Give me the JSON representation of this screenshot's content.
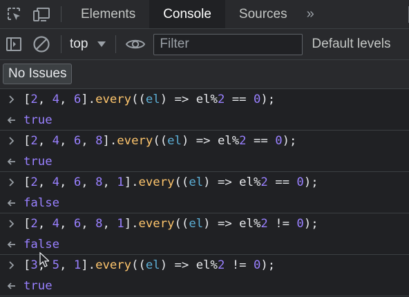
{
  "tabs": {
    "elements": "Elements",
    "console": "Console",
    "sources": "Sources",
    "more": "»"
  },
  "toolbar": {
    "context": "top",
    "filter_placeholder": "Filter",
    "levels": "Default levels"
  },
  "issues": {
    "label": "No Issues"
  },
  "colors": {
    "number": "#9980ff",
    "method": "#ffc66d",
    "param": "#5db0d7",
    "boolean": "#9980ff"
  },
  "entries": [
    {
      "input": [
        {
          "t": "[",
          "c": "plain"
        },
        {
          "t": "2",
          "c": "num"
        },
        {
          "t": ", ",
          "c": "plain"
        },
        {
          "t": "4",
          "c": "num"
        },
        {
          "t": ", ",
          "c": "plain"
        },
        {
          "t": "6",
          "c": "num"
        },
        {
          "t": "].",
          "c": "plain"
        },
        {
          "t": "every",
          "c": "fn"
        },
        {
          "t": "((",
          "c": "plain"
        },
        {
          "t": "el",
          "c": "param"
        },
        {
          "t": ") => el%",
          "c": "plain"
        },
        {
          "t": "2",
          "c": "num"
        },
        {
          "t": " == ",
          "c": "plain"
        },
        {
          "t": "0",
          "c": "num"
        },
        {
          "t": ");",
          "c": "plain"
        }
      ],
      "result": "true"
    },
    {
      "input": [
        {
          "t": "[",
          "c": "plain"
        },
        {
          "t": "2",
          "c": "num"
        },
        {
          "t": ", ",
          "c": "plain"
        },
        {
          "t": "4",
          "c": "num"
        },
        {
          "t": ", ",
          "c": "plain"
        },
        {
          "t": "6",
          "c": "num"
        },
        {
          "t": ", ",
          "c": "plain"
        },
        {
          "t": "8",
          "c": "num"
        },
        {
          "t": "].",
          "c": "plain"
        },
        {
          "t": "every",
          "c": "fn"
        },
        {
          "t": "((",
          "c": "plain"
        },
        {
          "t": "el",
          "c": "param"
        },
        {
          "t": ") => el%",
          "c": "plain"
        },
        {
          "t": "2",
          "c": "num"
        },
        {
          "t": " == ",
          "c": "plain"
        },
        {
          "t": "0",
          "c": "num"
        },
        {
          "t": ");",
          "c": "plain"
        }
      ],
      "result": "true"
    },
    {
      "input": [
        {
          "t": "[",
          "c": "plain"
        },
        {
          "t": "2",
          "c": "num"
        },
        {
          "t": ", ",
          "c": "plain"
        },
        {
          "t": "4",
          "c": "num"
        },
        {
          "t": ", ",
          "c": "plain"
        },
        {
          "t": "6",
          "c": "num"
        },
        {
          "t": ", ",
          "c": "plain"
        },
        {
          "t": "8",
          "c": "num"
        },
        {
          "t": ", ",
          "c": "plain"
        },
        {
          "t": "1",
          "c": "num"
        },
        {
          "t": "].",
          "c": "plain"
        },
        {
          "t": "every",
          "c": "fn"
        },
        {
          "t": "((",
          "c": "plain"
        },
        {
          "t": "el",
          "c": "param"
        },
        {
          "t": ") => el%",
          "c": "plain"
        },
        {
          "t": "2",
          "c": "num"
        },
        {
          "t": " == ",
          "c": "plain"
        },
        {
          "t": "0",
          "c": "num"
        },
        {
          "t": ");",
          "c": "plain"
        }
      ],
      "result": "false"
    },
    {
      "input": [
        {
          "t": "[",
          "c": "plain"
        },
        {
          "t": "2",
          "c": "num"
        },
        {
          "t": ", ",
          "c": "plain"
        },
        {
          "t": "4",
          "c": "num"
        },
        {
          "t": ", ",
          "c": "plain"
        },
        {
          "t": "6",
          "c": "num"
        },
        {
          "t": ", ",
          "c": "plain"
        },
        {
          "t": "8",
          "c": "num"
        },
        {
          "t": ", ",
          "c": "plain"
        },
        {
          "t": "1",
          "c": "num"
        },
        {
          "t": "].",
          "c": "plain"
        },
        {
          "t": "every",
          "c": "fn"
        },
        {
          "t": "((",
          "c": "plain"
        },
        {
          "t": "el",
          "c": "param"
        },
        {
          "t": ") => el%",
          "c": "plain"
        },
        {
          "t": "2",
          "c": "num"
        },
        {
          "t": " != ",
          "c": "plain"
        },
        {
          "t": "0",
          "c": "num"
        },
        {
          "t": ");",
          "c": "plain"
        }
      ],
      "result": "false"
    },
    {
      "input": [
        {
          "t": "[",
          "c": "plain"
        },
        {
          "t": "3",
          "c": "num"
        },
        {
          "t": ", ",
          "c": "plain"
        },
        {
          "t": "5",
          "c": "num"
        },
        {
          "t": ", ",
          "c": "plain"
        },
        {
          "t": "1",
          "c": "num"
        },
        {
          "t": "].",
          "c": "plain"
        },
        {
          "t": "every",
          "c": "fn"
        },
        {
          "t": "((",
          "c": "plain"
        },
        {
          "t": "el",
          "c": "param"
        },
        {
          "t": ") => el%",
          "c": "plain"
        },
        {
          "t": "2",
          "c": "num"
        },
        {
          "t": " != ",
          "c": "plain"
        },
        {
          "t": "0",
          "c": "num"
        },
        {
          "t": ");",
          "c": "plain"
        }
      ],
      "result": "true"
    }
  ]
}
